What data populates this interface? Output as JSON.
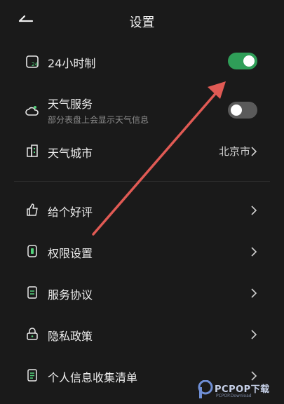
{
  "header": {
    "title": "设置"
  },
  "rows": {
    "clock": {
      "label": "24小时制",
      "toggle_on": true
    },
    "weather": {
      "label": "天气服务",
      "sub": "部分表盘上会显示天气信息",
      "toggle_on": false
    },
    "city": {
      "label": "天气城市",
      "value": "北京市"
    },
    "rate": {
      "label": "给个好评"
    },
    "perm": {
      "label": "权限设置"
    },
    "agreement": {
      "label": "服务协议"
    },
    "privacy": {
      "label": "隐私政策"
    },
    "info": {
      "label": "个人信息收集清单"
    }
  },
  "watermark": {
    "text": "PCPOP下载",
    "small": "PCPOP.Download"
  },
  "colors": {
    "accent": "#2f9e58",
    "toggle_off": "#5a5a5a",
    "annotation": "#e05a54",
    "icon_green": "#52d07a"
  }
}
